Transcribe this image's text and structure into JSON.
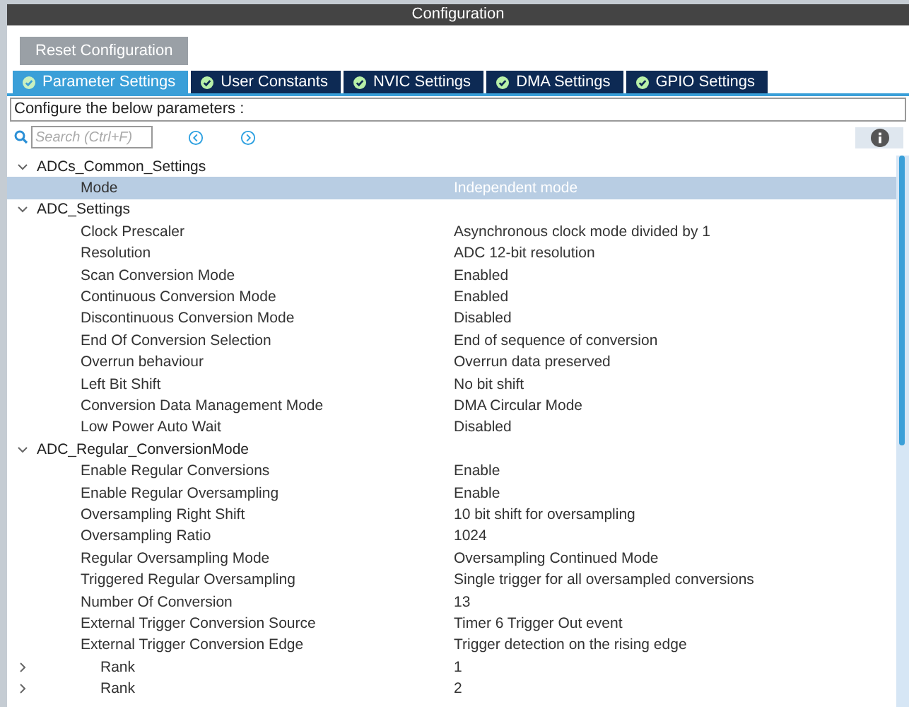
{
  "window": {
    "title": "Configuration"
  },
  "reset_button": "Reset Configuration",
  "tabs": [
    {
      "label": "Parameter Settings",
      "selected": true
    },
    {
      "label": "User Constants",
      "selected": false
    },
    {
      "label": "NVIC Settings",
      "selected": false
    },
    {
      "label": "DMA Settings",
      "selected": false
    },
    {
      "label": "GPIO Settings",
      "selected": false
    }
  ],
  "description": "Configure the below parameters :",
  "search": {
    "placeholder": "Search (Ctrl+F)"
  },
  "groups": [
    {
      "name": "ADCs_Common_Settings",
      "expanded": true,
      "params": [
        {
          "name": "Mode",
          "value": "Independent mode",
          "selected": true
        }
      ]
    },
    {
      "name": "ADC_Settings",
      "expanded": true,
      "params": [
        {
          "name": "Clock Prescaler",
          "value": "Asynchronous clock mode divided by 1",
          "selected": false
        },
        {
          "name": "Resolution",
          "value": "ADC 12-bit resolution",
          "selected": false
        },
        {
          "name": "Scan Conversion Mode",
          "value": "Enabled",
          "selected": false
        },
        {
          "name": "Continuous Conversion Mode",
          "value": "Enabled",
          "selected": false
        },
        {
          "name": "Discontinuous Conversion Mode",
          "value": "Disabled",
          "selected": false
        },
        {
          "name": "End Of Conversion Selection",
          "value": "End of sequence of conversion",
          "selected": false
        },
        {
          "name": "Overrun behaviour",
          "value": "Overrun data preserved",
          "selected": false
        },
        {
          "name": "Left Bit Shift",
          "value": "No bit shift",
          "selected": false
        },
        {
          "name": "Conversion Data Management Mode",
          "value": "DMA Circular Mode",
          "selected": false
        },
        {
          "name": "Low Power Auto Wait",
          "value": "Disabled",
          "selected": false
        }
      ]
    },
    {
      "name": "ADC_Regular_ConversionMode",
      "expanded": true,
      "params": [
        {
          "name": "Enable Regular Conversions",
          "value": "Enable",
          "selected": false
        },
        {
          "name": "Enable Regular Oversampling",
          "value": "Enable",
          "selected": false
        },
        {
          "name": "Oversampling Right Shift",
          "value": "10 bit shift for oversampling",
          "selected": false
        },
        {
          "name": "Oversampling Ratio",
          "value": "1024",
          "selected": false
        },
        {
          "name": "Regular Oversampling Mode",
          "value": "Oversampling Continued Mode",
          "selected": false
        },
        {
          "name": "Triggered Regular Oversampling",
          "value": "Single trigger for all oversampled conversions",
          "selected": false
        },
        {
          "name": "Number Of Conversion",
          "value": "13",
          "selected": false
        },
        {
          "name": "External Trigger Conversion Source",
          "value": "Timer 6 Trigger Out event",
          "selected": false
        },
        {
          "name": "External Trigger Conversion Edge",
          "value": "Trigger detection on the rising edge",
          "selected": false
        },
        {
          "name": "Rank",
          "value": "1",
          "selected": false,
          "expanded": false
        },
        {
          "name": "Rank",
          "value": "2",
          "selected": false,
          "expanded": false
        }
      ]
    }
  ]
}
